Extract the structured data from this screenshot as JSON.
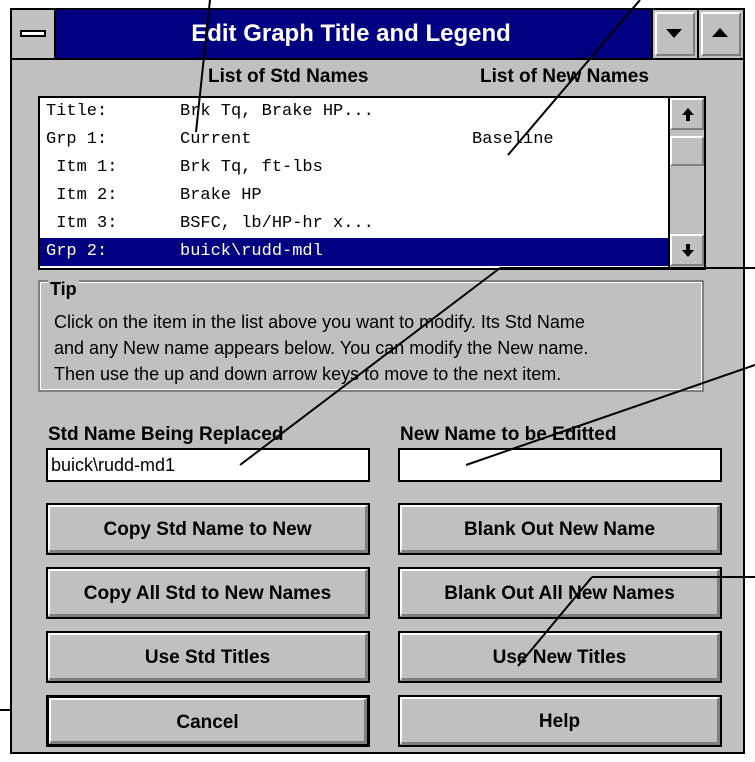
{
  "window": {
    "title": "Edit Graph Title and Legend"
  },
  "headers": {
    "std": "List of Std Names",
    "new": "List of New Names"
  },
  "list": {
    "rows": [
      {
        "col1": "Title:",
        "col2": "Brk Tq, Brake HP...",
        "col3": "",
        "selected": false
      },
      {
        "col1": "Grp 1:",
        "col2": "Current",
        "col3": "Baseline",
        "selected": false
      },
      {
        "col1": " Itm 1:",
        "col2": "Brk Tq, ft-lbs",
        "col3": "",
        "selected": false
      },
      {
        "col1": " Itm 2:",
        "col2": "Brake HP",
        "col3": "",
        "selected": false
      },
      {
        "col1": " Itm 3:",
        "col2": "BSFC, lb/HP-hr x...",
        "col3": "",
        "selected": false
      },
      {
        "col1": "Grp 2:",
        "col2": "buick\\rudd-mdl",
        "col3": "",
        "selected": true
      }
    ]
  },
  "tip": {
    "label": "Tip",
    "lines": [
      "Click on the item in the list above you want to modify.  Its Std Name",
      "and any New name appears below.  You can modify the New name.",
      "Then use the up and down arrow keys to move to the next item."
    ]
  },
  "fields": {
    "std_label": "Std Name Being Replaced",
    "std_value": "buick\\rudd-md1",
    "new_label": "New Name to be Editted",
    "new_value": ""
  },
  "buttons": {
    "copy_std": "Copy Std Name to New",
    "blank_new": "Blank Out New Name",
    "copy_all": "Copy All Std to New Names",
    "blank_all": "Blank Out All New Names",
    "use_std": "Use Std Titles",
    "use_new": "Use New Titles",
    "cancel": "Cancel",
    "help": "Help"
  },
  "colors": {
    "titlebar": "#000080",
    "face": "#c0c0c0",
    "selection": "#000080"
  },
  "icons": [
    "system-menu-icon",
    "minimize-arrow-icon",
    "maximize-arrow-icon",
    "scroll-up-arrow-icon",
    "scroll-down-arrow-icon"
  ]
}
